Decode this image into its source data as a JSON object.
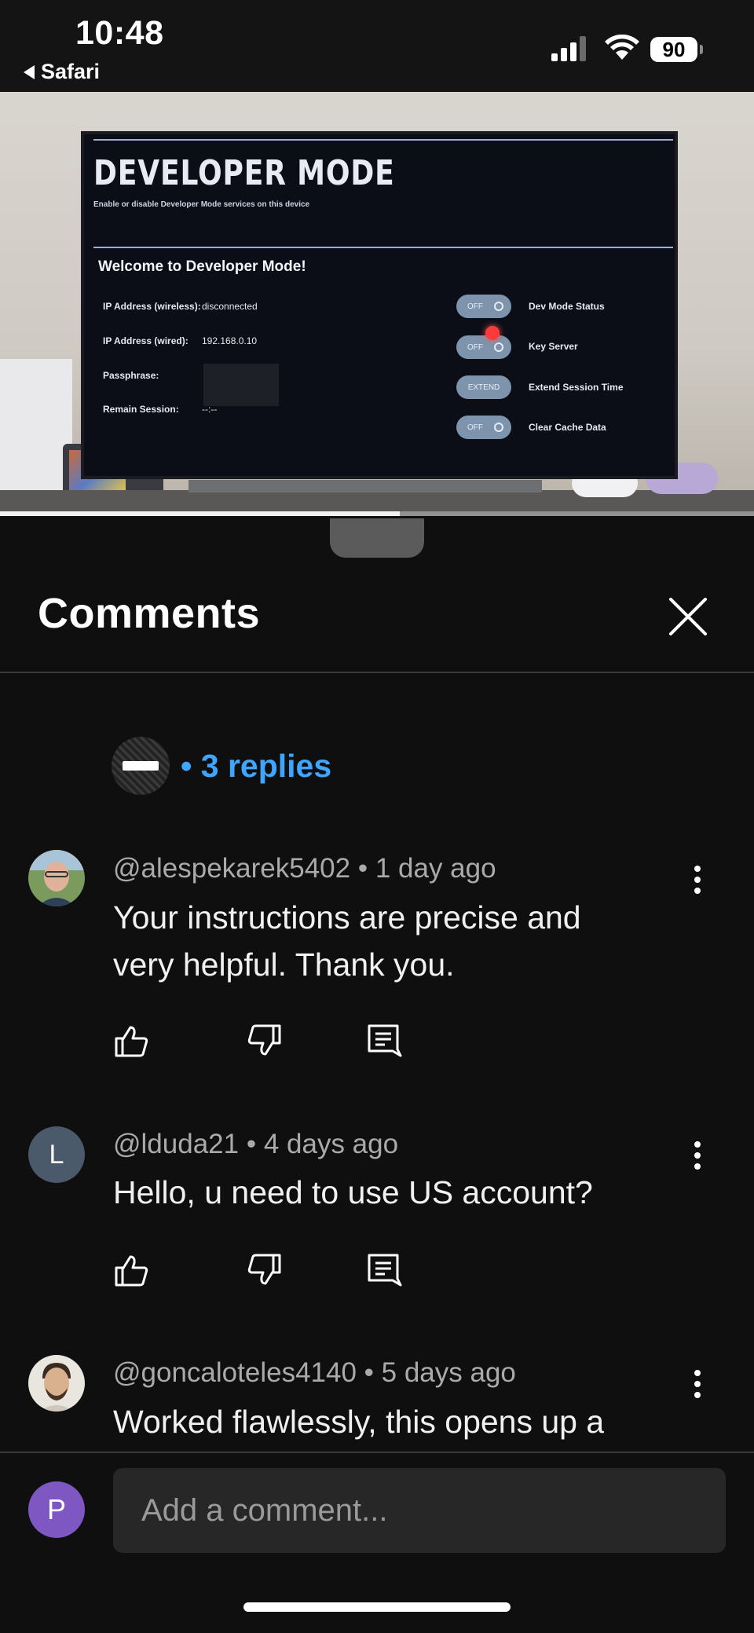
{
  "status_bar": {
    "time": "10:48",
    "back_app": "Safari",
    "battery": "90"
  },
  "video": {
    "progress_fraction": 0.53,
    "tv": {
      "title": "DEVELOPER MODE",
      "subtitle": "Enable or disable Developer Mode services on this device",
      "welcome": "Welcome to Developer Mode!",
      "fields": [
        {
          "label": "IP Address (wireless):",
          "value": "disconnected"
        },
        {
          "label": "IP Address (wired):",
          "value": "192.168.0.10"
        },
        {
          "label": "Passphrase:",
          "value": ""
        },
        {
          "label": "Remain Session:",
          "value": "--:--"
        }
      ],
      "options": [
        {
          "button": "OFF",
          "label": "Dev Mode Status"
        },
        {
          "button": "OFF",
          "label": "Key Server"
        },
        {
          "button": "EXTEND",
          "label": "Extend Session Time"
        },
        {
          "button": "OFF",
          "label": "Clear Cache Data"
        }
      ]
    }
  },
  "sheet": {
    "title": "Comments",
    "replies_label": "• 3 replies",
    "comments": [
      {
        "handle": "@alespekarek5402",
        "age": "• 1 day ago",
        "text_lines": [
          "Your instructions are precise and",
          "very helpful.  Thank you."
        ],
        "avatar_initial": ""
      },
      {
        "handle": "@lduda21",
        "age": "• 4 days ago",
        "text_lines": [
          "Hello, u need to use US account?"
        ],
        "avatar_initial": "L"
      },
      {
        "handle": "@goncaloteles4140",
        "age": "• 5 days ago",
        "text_lines": [
          "Worked flawlessly, this opens up a"
        ],
        "avatar_initial": ""
      }
    ]
  },
  "composer": {
    "user_initial": "P",
    "placeholder": "Add a comment..."
  },
  "colors": {
    "background": "#0f0f0f",
    "accent_link": "#3ea6ff",
    "user_avatar": "#7e57c2",
    "initial_avatar": "#4a5a6a"
  },
  "icons": [
    "close-icon",
    "like-icon",
    "dislike-icon",
    "reply-icon",
    "more-vert-icon",
    "signal-icon",
    "wifi-icon",
    "battery-icon"
  ]
}
